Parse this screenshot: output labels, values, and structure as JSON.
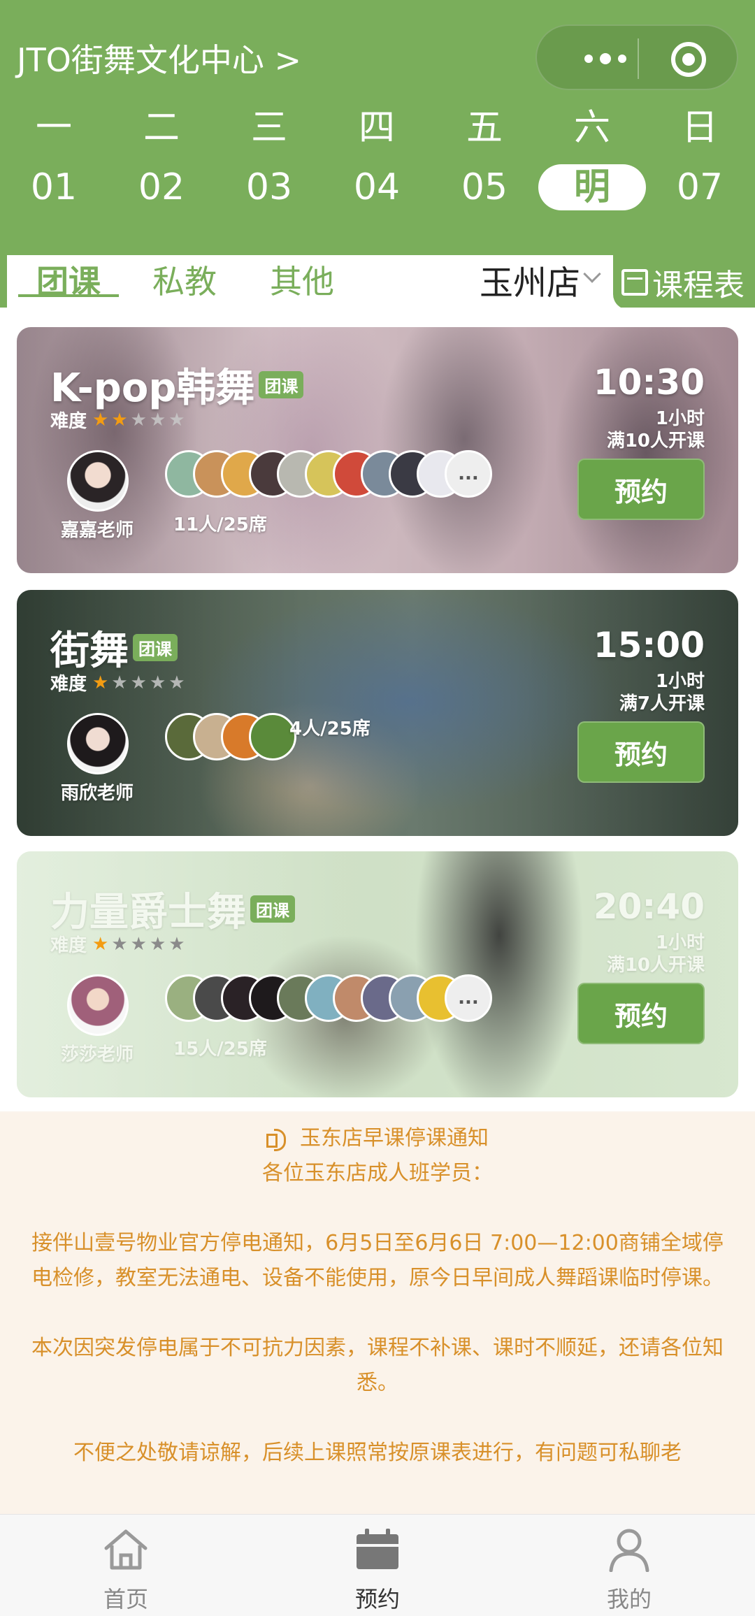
{
  "header": {
    "title": "JTO街舞文化中心 >",
    "weekdays": [
      "一",
      "二",
      "三",
      "四",
      "五",
      "六",
      "日"
    ],
    "dates": [
      "01",
      "02",
      "03",
      "04",
      "05",
      "明",
      "07"
    ],
    "selected_date": "明"
  },
  "tabs": {
    "items": [
      "团课",
      "私教",
      "其他"
    ],
    "active": "团课",
    "store": "玉州店",
    "schedule_label": "课程表"
  },
  "courses": [
    {
      "title": "K-pop韩舞",
      "tag": "团课",
      "difficulty_label": "难度",
      "difficulty": 2,
      "teacher": "嘉嘉老师",
      "seats": "11人/25席",
      "time": "10:30",
      "duration": "1小时",
      "min_people": "满10人开课",
      "button": "预约",
      "more": "..."
    },
    {
      "title": "街舞",
      "tag": "团课",
      "difficulty_label": "难度",
      "difficulty": 1,
      "teacher": "雨欣老师",
      "seats": "4人/25席",
      "time": "15:00",
      "duration": "1小时",
      "min_people": "满7人开课",
      "button": "预约"
    },
    {
      "title": "力量爵士舞",
      "tag": "团课",
      "difficulty_label": "难度",
      "difficulty": 1,
      "teacher": "莎莎老师",
      "seats": "15人/25席",
      "time": "20:40",
      "duration": "1小时",
      "min_people": "满10人开课",
      "button": "预约",
      "more": "..."
    }
  ],
  "notice": {
    "title": "玉东店早课停课通知",
    "body": "各位玉东店成人班学员：\n\n接伴山壹号物业官方停电通知，6月5日至6月6日 7:00—12:00商铺全域停电检修，教室无法通电、设备不能使用，原今日早间成人舞蹈课临时停课。\n\n本次因突发停电属于不可抗力因素，课程不补课、课时不顺延，还请各位知悉。\n\n不便之处敬请谅解，后续上课照常按原课表进行，有问题可私聊老"
  },
  "bottom_nav": {
    "items": [
      "首页",
      "预约",
      "我的"
    ],
    "active": "预约"
  },
  "colors": {
    "primary": "#7aae5b",
    "notice_text": "#d8902a",
    "star_on": "#f39c12"
  }
}
